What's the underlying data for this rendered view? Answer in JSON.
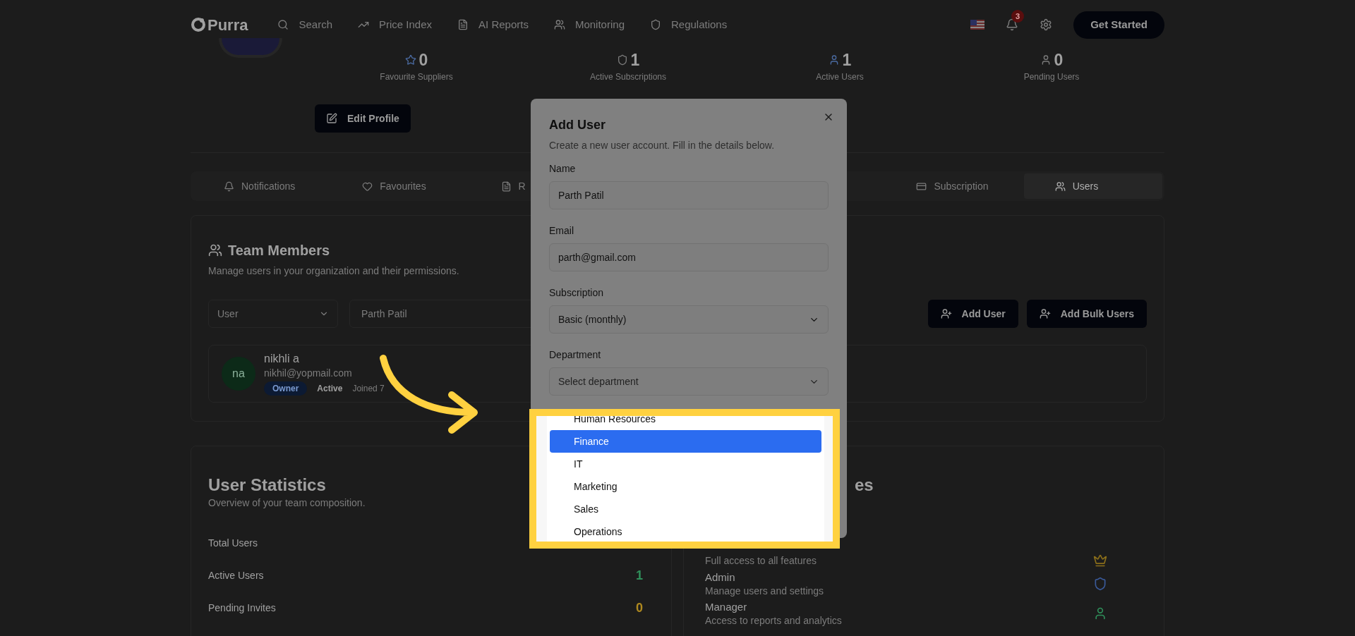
{
  "nav": {
    "logo": "Purra",
    "links": [
      "Search",
      "Price Index",
      "AI Reports",
      "Monitoring",
      "Regulations"
    ],
    "notification_count": "3",
    "cta": "Get Started"
  },
  "profile": {
    "stats": [
      {
        "value": "0",
        "label": "Favourite Suppliers"
      },
      {
        "value": "1",
        "label": "Active Subscriptions"
      },
      {
        "value": "1",
        "label": "Active Users"
      },
      {
        "value": "0",
        "label": "Pending Users"
      }
    ],
    "edit_button": "Edit Profile"
  },
  "tabs": [
    {
      "label": "Notifications",
      "selected": false
    },
    {
      "label": "Favourites",
      "selected": false
    },
    {
      "label": "R",
      "selected": false
    },
    {
      "label": "Subscription",
      "selected": false
    },
    {
      "label": "Users",
      "selected": true
    }
  ],
  "team": {
    "title": "Team Members",
    "subtitle": "Manage users in your organization and their permissions.",
    "role_filter": "User",
    "search_value": "Parth Patil",
    "buttons": [
      "Add User",
      "Add Bulk Users"
    ],
    "members": [
      {
        "initials": "na",
        "name": "nikhli a",
        "email": "nikhil@yopmail.com",
        "role": "Owner",
        "status": "Active",
        "joined": "Joined 7"
      }
    ]
  },
  "user_statistics": {
    "title": "User Statistics",
    "subtitle": "Overview of your team composition.",
    "rows": [
      {
        "label": "Total Users"
      },
      {
        "label": "Active Users",
        "value": "1",
        "color": "#2f8f5a"
      },
      {
        "label": "Pending Invites",
        "value": "0",
        "color": "#b08a1f"
      }
    ]
  },
  "roles": {
    "title": "es",
    "items": [
      {
        "description": "Full access to all features"
      },
      {
        "name": "Admin",
        "description": "Manage users and settings"
      },
      {
        "name": "Manager",
        "description": "Access to reports and analytics"
      }
    ]
  },
  "dialog": {
    "title": "Add User",
    "description": "Create a new user account. Fill in the details below.",
    "fields": [
      {
        "label": "Name",
        "kind": "input",
        "value": "Parth Patil"
      },
      {
        "label": "Email",
        "kind": "input",
        "value": "parth@gmail.com"
      },
      {
        "label": "Subscription",
        "kind": "select",
        "value": "Basic (monthly)"
      },
      {
        "label": "Department",
        "kind": "select",
        "placeholder": "Select department"
      }
    ],
    "department_options": [
      {
        "label": "Human Resources",
        "selected": false
      },
      {
        "label": "Finance",
        "selected": true
      },
      {
        "label": "IT",
        "selected": false
      },
      {
        "label": "Marketing",
        "selected": false
      },
      {
        "label": "Sales",
        "selected": false
      },
      {
        "label": "Operations",
        "selected": false
      }
    ]
  }
}
